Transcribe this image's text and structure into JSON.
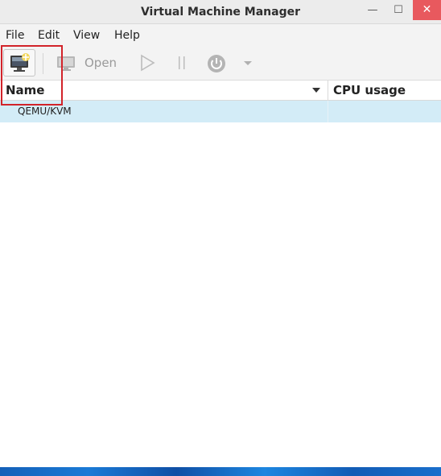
{
  "window": {
    "title": "Virtual Machine Manager",
    "controls": {
      "minimize": "—",
      "maximize": "☐",
      "close": "✕"
    }
  },
  "menubar": {
    "items": [
      "File",
      "Edit",
      "View",
      "Help"
    ]
  },
  "toolbar": {
    "new_vm_icon": "monitor-new-icon",
    "open_label": "Open",
    "run_icon": "play-icon",
    "pause_icon": "pause-icon",
    "shutdown_icon": "power-icon",
    "dropdown_icon": "chevron-down-icon"
  },
  "table": {
    "columns": [
      "Name",
      "CPU usage"
    ],
    "rows": [
      {
        "name": "QEMU/KVM",
        "cpu_usage": ""
      }
    ]
  },
  "colors": {
    "selected_row": "#d3ecf7",
    "highlight_border": "#d2232a",
    "close_button": "#e8595e"
  }
}
